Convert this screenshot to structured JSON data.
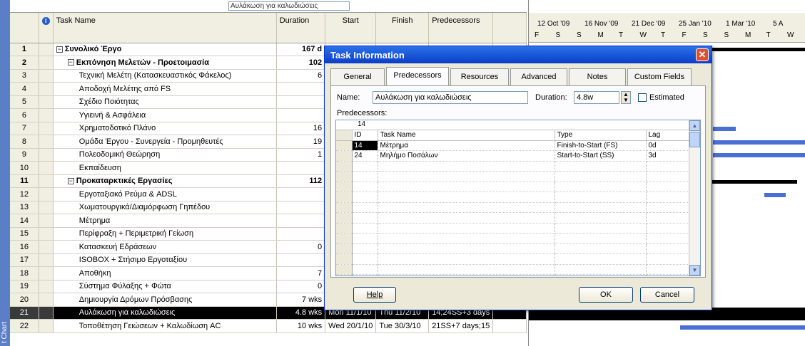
{
  "view_bar": {
    "label": "t Chart"
  },
  "top_entry": {
    "value": "Αυλάκωση για καλωδιώσεις"
  },
  "table": {
    "headers": {
      "info": "i",
      "task_name": "Task Name",
      "duration": "Duration",
      "start": "Start",
      "finish": "Finish",
      "predecessors": "Predecessors"
    },
    "rows": [
      {
        "id": "1",
        "name": "Συνολικό Έργο",
        "duration": "167 d",
        "start": "",
        "finish": "",
        "pred": "",
        "level": 0,
        "bold": true,
        "summary": true
      },
      {
        "id": "2",
        "name": "Εκπόνηση Μελετών - Προετοιμασία",
        "duration": "102",
        "start": "",
        "finish": "",
        "pred": "",
        "level": 1,
        "bold": true,
        "summary": true
      },
      {
        "id": "3",
        "name": "Τεχνική Μελέτη (Κατασκευαστικός Φάκελος)",
        "duration": "6",
        "start": "",
        "finish": "",
        "pred": "",
        "level": 2
      },
      {
        "id": "4",
        "name": "Αποδοχή Μελέτης από FS",
        "duration": "",
        "start": "",
        "finish": "",
        "pred": "",
        "level": 2
      },
      {
        "id": "5",
        "name": "Σχέδιο Ποιότητας",
        "duration": "",
        "start": "",
        "finish": "",
        "pred": "",
        "level": 2
      },
      {
        "id": "6",
        "name": "Υγιεινή & Ασφάλεια",
        "duration": "",
        "start": "",
        "finish": "",
        "pred": "",
        "level": 2
      },
      {
        "id": "7",
        "name": "Χρηματοδοτικό Πλάνο",
        "duration": "16",
        "start": "",
        "finish": "",
        "pred": "",
        "level": 2
      },
      {
        "id": "8",
        "name": "Ομάδα Έργου - Συνεργεία - Προμηθευτές",
        "duration": "19",
        "start": "",
        "finish": "",
        "pred": "",
        "level": 2
      },
      {
        "id": "9",
        "name": "Πολεοδομική Θεώρηση",
        "duration": "1",
        "start": "",
        "finish": "",
        "pred": "",
        "level": 2
      },
      {
        "id": "10",
        "name": "Εκπαίδευση",
        "duration": "",
        "start": "",
        "finish": "",
        "pred": "",
        "level": 2
      },
      {
        "id": "11",
        "name": "Προκαταρκτικές Εργασίες",
        "duration": "112",
        "start": "",
        "finish": "",
        "pred": "",
        "level": 1,
        "bold": true,
        "summary": true
      },
      {
        "id": "12",
        "name": "Εργοταξιακό Ρεύμα & ADSL",
        "duration": "",
        "start": "",
        "finish": "",
        "pred": "",
        "level": 2
      },
      {
        "id": "13",
        "name": "Χωματουργικά/Διαμόρφωση Γηπέδου",
        "duration": "",
        "start": "",
        "finish": "",
        "pred": "",
        "level": 2
      },
      {
        "id": "14",
        "name": "Μέτρημα",
        "duration": "",
        "start": "",
        "finish": "",
        "pred": "",
        "level": 2
      },
      {
        "id": "15",
        "name": "Περίφραξη + Περιμετρική Γείωση",
        "duration": "",
        "start": "",
        "finish": "",
        "pred": "",
        "level": 2
      },
      {
        "id": "16",
        "name": "Κατασκευή Εδράσεων",
        "duration": "0",
        "start": "",
        "finish": "",
        "pred": "",
        "level": 2
      },
      {
        "id": "17",
        "name": "ISOBOX + Στήσιμο Εργοταξίου",
        "duration": "",
        "start": "",
        "finish": "",
        "pred": "",
        "level": 2
      },
      {
        "id": "18",
        "name": "Αποθήκη",
        "duration": "7",
        "start": "",
        "finish": "",
        "pred": "",
        "level": 2
      },
      {
        "id": "19",
        "name": "Σύστημα Φύλαξης + Φώτα",
        "duration": "0",
        "start": "",
        "finish": "",
        "pred": "",
        "level": 2
      },
      {
        "id": "20",
        "name": "Δημιουργία Δρόμων Πρόσβασης",
        "duration": "7 wks",
        "start": "Fri 30/10/09",
        "finish": "Thu 17/12/09",
        "pred": "15SS",
        "level": 2
      },
      {
        "id": "21",
        "name": "Αυλάκωση για καλωδιώσεις",
        "duration": "4.8 wks",
        "start": "Mon 11/1/10",
        "finish": "Thu 11/2/10",
        "pred": "14;24SS+3 days",
        "level": 2,
        "selected": true
      },
      {
        "id": "22",
        "name": "Τοποθέτηση Γειώσεων + Καλωδίωση AC",
        "duration": "10 wks",
        "start": "Wed 20/1/10",
        "finish": "Tue 30/3/10",
        "pred": "21SS+7 days;15",
        "level": 2
      }
    ]
  },
  "gantt": {
    "weeks": [
      "12 Oct '09",
      "16 Nov '09",
      "21 Dec '09",
      "25 Jan '10",
      "1 Mar '10",
      "5 A"
    ],
    "days": [
      "F",
      "S",
      "S",
      "M",
      "T",
      "W",
      "T",
      "F",
      "S",
      "S",
      "M",
      "T",
      "W"
    ]
  },
  "dialog": {
    "title": "Task Information",
    "tabs": [
      "General",
      "Predecessors",
      "Resources",
      "Advanced",
      "Notes",
      "Custom Fields"
    ],
    "active_tab": "Predecessors",
    "name_label": "Name:",
    "name_value": "Αυλάκωση για καλωδιώσεις",
    "duration_label": "Duration:",
    "duration_value": "4.8w",
    "estimated_label": "Estimated",
    "predecessors_label": "Predecessors:",
    "edit_value": "14",
    "pred_headers": {
      "id": "ID",
      "task_name": "Task Name",
      "type": "Type",
      "lag": "Lag"
    },
    "pred_rows": [
      {
        "id": "14",
        "name": "Μέτρημα",
        "type": "Finish-to-Start (FS)",
        "lag": "0d"
      },
      {
        "id": "24",
        "name": "Μηλήμο Ποσάλων",
        "type": "Start-to-Start (SS)",
        "lag": "3d"
      }
    ],
    "help_label": "Help",
    "ok_label": "OK",
    "cancel_label": "Cancel"
  }
}
